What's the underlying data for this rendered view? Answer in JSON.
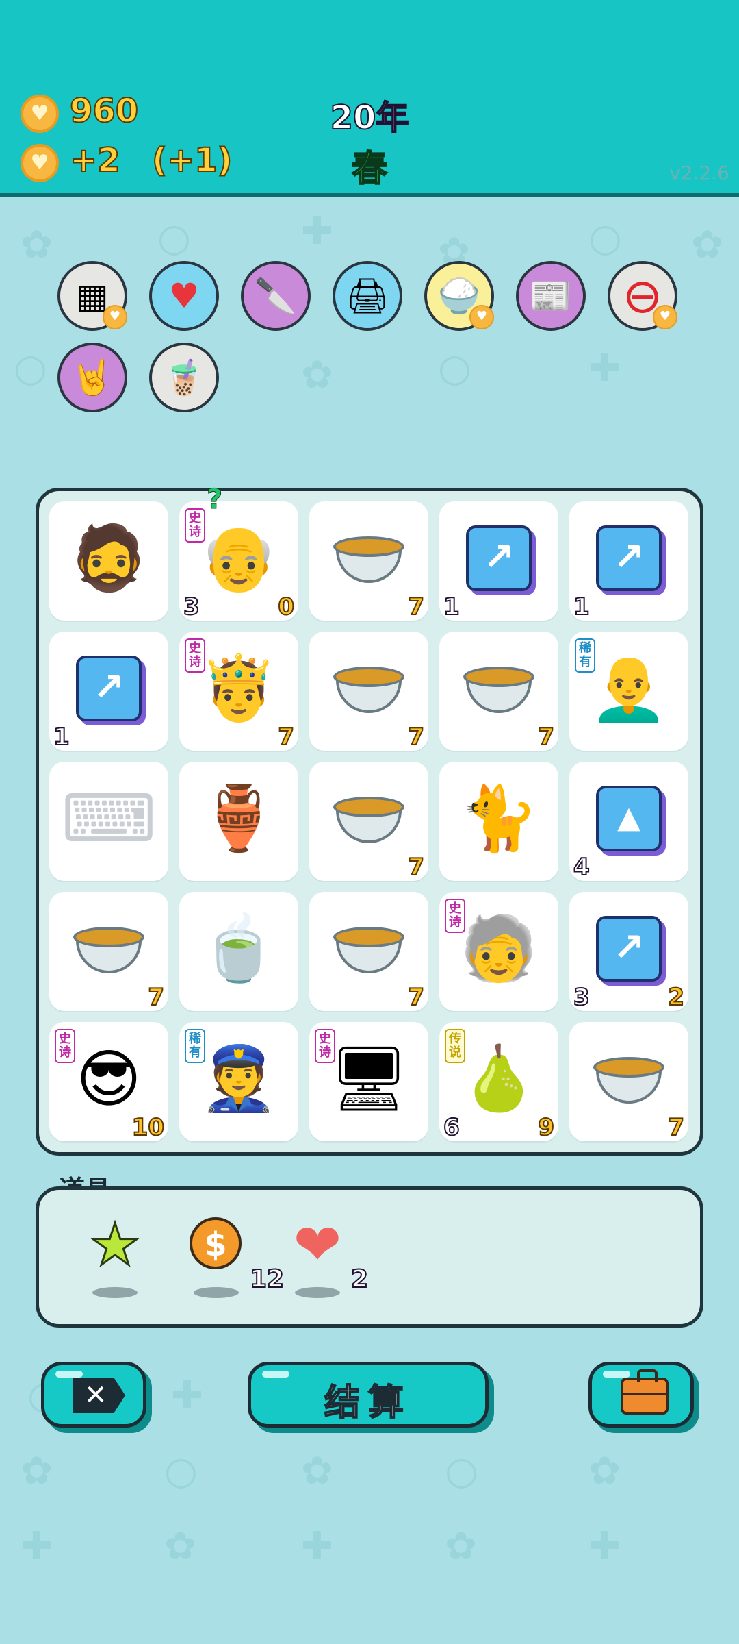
{
  "header": {
    "coins": "960",
    "income": "+2",
    "income_bonus": "(+1)",
    "year": "20年",
    "season": "春",
    "version": "v2.2.6"
  },
  "relics": [
    {
      "name": "sugar-cubes-icon",
      "color": "#e6e6e2"
    },
    {
      "name": "heart-drip-icon",
      "color": "#7fd6f0"
    },
    {
      "name": "cleaver-icon",
      "color": "#c98bd9"
    },
    {
      "name": "printer-warning-icon",
      "color": "#7fd6f0"
    },
    {
      "name": "rice-bowl-icon",
      "color": "#fbf09a"
    },
    {
      "name": "time-magazine-icon",
      "color": "#c98bd9"
    },
    {
      "name": "minus-circle-icon",
      "color": "#e6e6e2"
    },
    {
      "name": "rock-hand-icon",
      "color": "#c98bd9"
    },
    {
      "name": "bubble-tea-icon",
      "color": "#e6e6e2"
    }
  ],
  "board": {
    "cells": [
      {
        "name": "old-chef-icon",
        "glyph": "🧔",
        "left": "",
        "right": "",
        "tag": ""
      },
      {
        "name": "grandpa-glasses-icon",
        "glyph": "👴",
        "left": "3",
        "right": "0",
        "tag": "史诗",
        "tag_type": "epic",
        "question": "?"
      },
      {
        "name": "soup-bowl-icon",
        "glyph": "soup",
        "left": "",
        "right": "7",
        "tag": ""
      },
      {
        "name": "stock-chart-icon",
        "glyph": "chart",
        "left": "1",
        "right": "",
        "tag": ""
      },
      {
        "name": "stock-chart-icon",
        "glyph": "chart",
        "left": "1",
        "right": "",
        "tag": ""
      },
      {
        "name": "stock-chart-icon",
        "glyph": "chart",
        "left": "1",
        "right": "",
        "tag": ""
      },
      {
        "name": "king-emoji-icon",
        "glyph": "🤴",
        "left": "",
        "right": "7",
        "tag": "史诗",
        "tag_type": "epic"
      },
      {
        "name": "soup-bowl-icon",
        "glyph": "soup",
        "left": "",
        "right": "7",
        "tag": ""
      },
      {
        "name": "soup-bowl-icon",
        "glyph": "soup",
        "left": "",
        "right": "7",
        "tag": ""
      },
      {
        "name": "bald-man-icon",
        "glyph": "👨‍🦲",
        "left": "",
        "right": "",
        "tag": "稀有",
        "tag_type": "rare"
      },
      {
        "name": "keyboard-icon",
        "glyph": "⌨",
        "left": "",
        "right": "",
        "tag": ""
      },
      {
        "name": "coin-jar-icon",
        "glyph": "🏺",
        "left": "",
        "right": "",
        "tag": ""
      },
      {
        "name": "soup-bowl-icon",
        "glyph": "soup",
        "left": "",
        "right": "7",
        "tag": ""
      },
      {
        "name": "cat-icon",
        "glyph": "🐈",
        "left": "",
        "right": "",
        "tag": ""
      },
      {
        "name": "gold-bars-icon",
        "glyph": "goldbars",
        "left": "4",
        "right": "",
        "tag": ""
      },
      {
        "name": "soup-bowl-icon",
        "glyph": "soup",
        "left": "",
        "right": "7",
        "tag": ""
      },
      {
        "name": "tea-bag-icon",
        "glyph": "🍵",
        "left": "",
        "right": "",
        "tag": ""
      },
      {
        "name": "soup-bowl-icon",
        "glyph": "soup",
        "left": "",
        "right": "7",
        "tag": ""
      },
      {
        "name": "old-man-glasses-icon",
        "glyph": "🧓",
        "left": "",
        "right": "",
        "tag": "史诗",
        "tag_type": "epic"
      },
      {
        "name": "stock-chart-icon",
        "glyph": "chart",
        "left": "3",
        "right": "2",
        "tag": ""
      },
      {
        "name": "cool-grandpa-icon",
        "glyph": "😎",
        "left": "",
        "right": "10",
        "tag": "史诗",
        "tag_type": "epic"
      },
      {
        "name": "police-officer-icon",
        "glyph": "👮",
        "left": "",
        "right": "",
        "tag": "稀有",
        "tag_type": "rare"
      },
      {
        "name": "graphics-card-icon",
        "glyph": "🖥",
        "left": "",
        "right": "",
        "tag": "史诗",
        "tag_type": "epic"
      },
      {
        "name": "pear-icon",
        "glyph": "🍐",
        "left": "6",
        "right": "9",
        "tag": "传说",
        "tag_type": "legend"
      },
      {
        "name": "soup-bowl-icon",
        "glyph": "soup",
        "left": "",
        "right": "7",
        "tag": ""
      }
    ]
  },
  "items": {
    "title": "道具",
    "list": [
      {
        "name": "star-icon",
        "glyph": "★",
        "color": "#b9e83a",
        "count": ""
      },
      {
        "name": "dollar-coin-icon",
        "glyph": "$",
        "color": "#f39a2a",
        "count": "12"
      },
      {
        "name": "liver-icon",
        "glyph": "❤",
        "color": "#f0645f",
        "count": "2"
      }
    ]
  },
  "buttons": {
    "settle": "结算"
  }
}
